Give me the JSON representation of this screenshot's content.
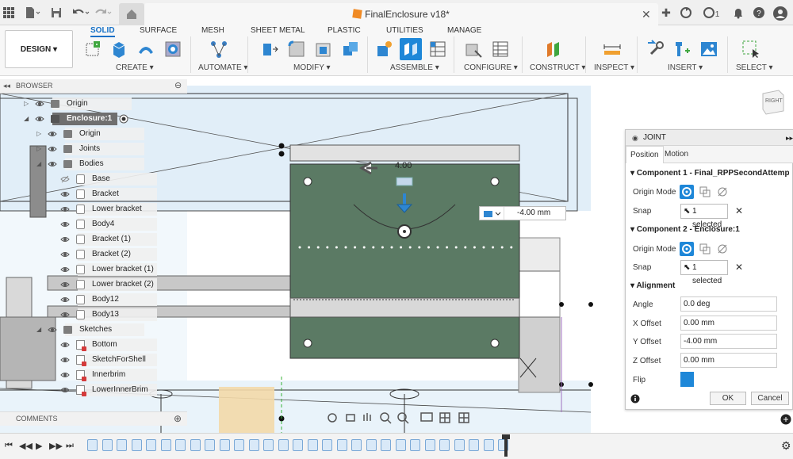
{
  "titlebar": {
    "document_title": "FinalEnclosure v18*",
    "notification_count": "1",
    "icons": [
      "grid-icon",
      "file-icon",
      "save-icon",
      "undo-icon",
      "redo-icon",
      "home-icon",
      "close-icon",
      "add-tab-icon",
      "sync-icon",
      "job-status-icon",
      "bell-icon",
      "help-icon",
      "account-icon"
    ]
  },
  "ribbon": {
    "workspace": "DESIGN",
    "tabs": [
      "SOLID",
      "SURFACE",
      "MESH",
      "SHEET METAL",
      "PLASTIC",
      "UTILITIES",
      "MANAGE"
    ],
    "active_tab": "SOLID",
    "groups": [
      "CREATE",
      "AUTOMATE",
      "MODIFY",
      "ASSEMBLE",
      "CONFIGURE",
      "CONSTRUCT",
      "INSPECT",
      "INSERT",
      "SELECT"
    ]
  },
  "browser": {
    "title": "BROWSER",
    "rows": [
      {
        "label": "Origin",
        "indent": 0,
        "kind": "folder",
        "arrow": "▷"
      },
      {
        "label": "Enclosure:1",
        "indent": 0,
        "kind": "component",
        "arrow": "◢",
        "selected": true
      },
      {
        "label": "Origin",
        "indent": 1,
        "kind": "folder",
        "arrow": "▷"
      },
      {
        "label": "Joints",
        "indent": 1,
        "kind": "folder",
        "arrow": "▷"
      },
      {
        "label": "Bodies",
        "indent": 1,
        "kind": "folder",
        "arrow": "◢"
      },
      {
        "label": "Base",
        "indent": 2,
        "kind": "body",
        "hidden": true
      },
      {
        "label": "Bracket",
        "indent": 2,
        "kind": "body"
      },
      {
        "label": "Lower bracket",
        "indent": 2,
        "kind": "body"
      },
      {
        "label": "Body4",
        "indent": 2,
        "kind": "body"
      },
      {
        "label": "Bracket (1)",
        "indent": 2,
        "kind": "body"
      },
      {
        "label": "Bracket (2)",
        "indent": 2,
        "kind": "body"
      },
      {
        "label": "Lower bracket (1)",
        "indent": 2,
        "kind": "body"
      },
      {
        "label": "Lower bracket (2)",
        "indent": 2,
        "kind": "body"
      },
      {
        "label": "Body12",
        "indent": 2,
        "kind": "body"
      },
      {
        "label": "Body13",
        "indent": 2,
        "kind": "body"
      },
      {
        "label": "Sketches",
        "indent": 1,
        "kind": "folder",
        "arrow": "◢"
      },
      {
        "label": "Bottom",
        "indent": 2,
        "kind": "sketch"
      },
      {
        "label": "SketchForShell",
        "indent": 2,
        "kind": "sketch"
      },
      {
        "label": "Innerbrim",
        "indent": 2,
        "kind": "sketch"
      },
      {
        "label": "LowerInnerBrim",
        "indent": 2,
        "kind": "sketch"
      }
    ]
  },
  "comments": {
    "title": "COMMENTS"
  },
  "viewport": {
    "dimension_label": "4.00",
    "offset_value": "-4.00 mm",
    "viewcube_face": "RIGHT"
  },
  "joint": {
    "title": "JOINT",
    "tabs": [
      "Position",
      "Motion"
    ],
    "active_tab": "Position",
    "component1": {
      "title": "Component 1 - Final_RPPSecondAttemp...",
      "origin_mode_label": "Origin Mode",
      "snap_label": "Snap",
      "snap_value": "1 selected"
    },
    "component2": {
      "title": "Component 2 - Enclosure:1",
      "origin_mode_label": "Origin Mode",
      "snap_label": "Snap",
      "snap_value": "1 selected"
    },
    "alignment": {
      "title": "Alignment",
      "angle_label": "Angle",
      "angle": "0.0 deg",
      "x_label": "X Offset",
      "x": "0.00 mm",
      "y_label": "Y Offset",
      "y": "-4.00 mm",
      "z_label": "Z Offset",
      "z": "0.00 mm",
      "flip_label": "Flip"
    },
    "ok": "OK",
    "cancel": "Cancel"
  },
  "colors": {
    "accent": "#1470c7",
    "pcb": "#5b7a64",
    "selection_blue": "#d6e8f5"
  }
}
